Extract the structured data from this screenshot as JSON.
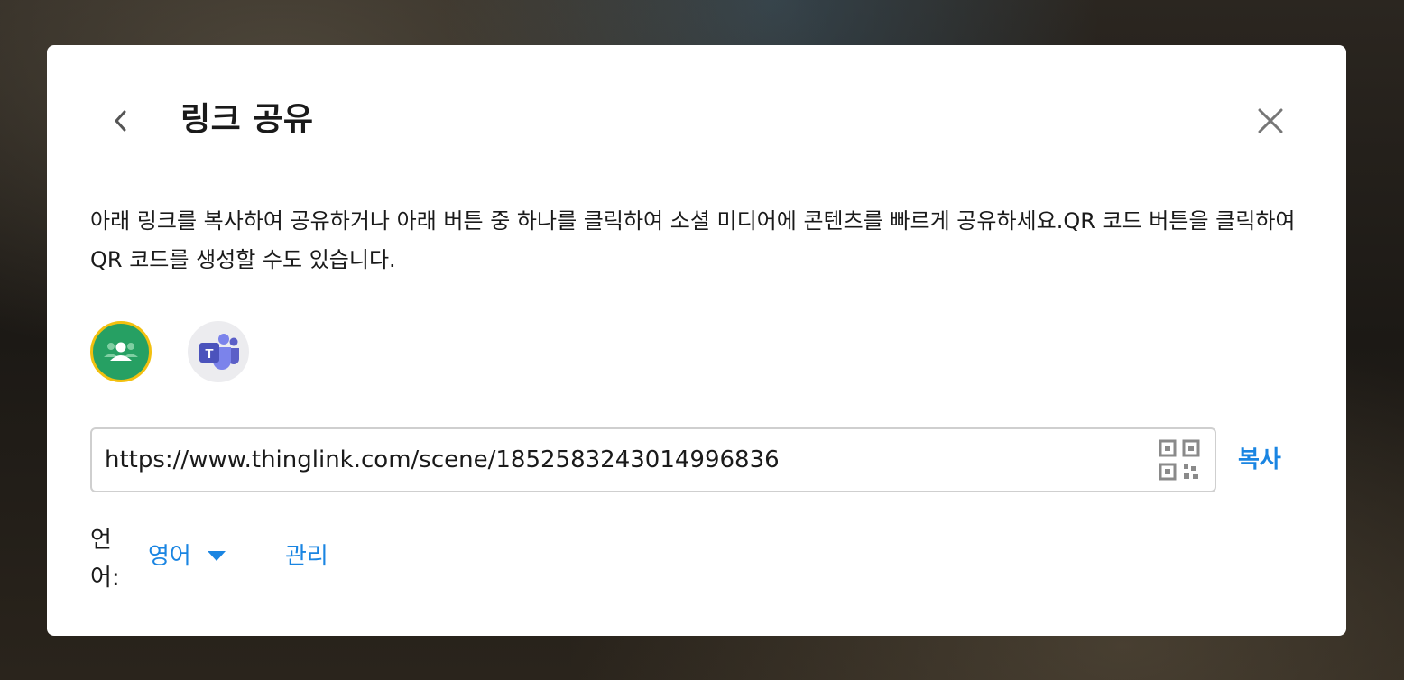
{
  "dialog": {
    "title": "링크 공유",
    "description": "아래 링크를 복사하여 공유하거나 아래 버튼 중 하나를 클릭하여 소셜 미디어에 콘텐츠를 빠르게 공유하세요.QR 코드 버튼을 클릭하여 QR 코드를 생성할 수도 있습니다.",
    "back_icon": "chevron-left-icon",
    "close_icon": "close-icon"
  },
  "share_buttons": [
    {
      "icon": "google-classroom-icon",
      "color": "#26a063",
      "highlight": "#f2c00f"
    },
    {
      "icon": "microsoft-teams-icon",
      "color": "#5b5fc7"
    }
  ],
  "link": {
    "value": "https://www.thinglink.com/scene/1852583243014996836",
    "qr_icon": "qr-code-icon",
    "copy_label": "복사"
  },
  "language": {
    "label": "언어:",
    "selected": "영어",
    "manage_label": "관리"
  },
  "colors": {
    "accent": "#1a85e2",
    "text": "#1a1a1a",
    "border": "#cfcfcf"
  }
}
